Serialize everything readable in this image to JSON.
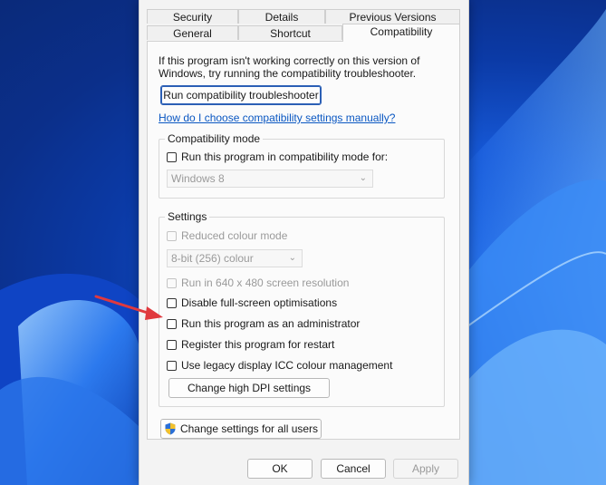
{
  "tabs": {
    "row1": [
      "Security",
      "Details",
      "Previous Versions"
    ],
    "row2": [
      "General",
      "Shortcut",
      "Compatibility"
    ]
  },
  "intro_text": "If this program isn't working correctly on this version of Windows, try running the compatibility troubleshooter.",
  "troubleshooter_button": "Run compatibility troubleshooter",
  "help_link": "How do I choose compatibility settings manually?",
  "compat_mode": {
    "title": "Compatibility mode",
    "checkbox": "Run this program in compatibility mode for:",
    "selected": "Windows 8"
  },
  "settings": {
    "title": "Settings",
    "reduced_colour": "Reduced colour mode",
    "colour_selected": "8-bit (256) colour",
    "res_640": "Run in 640 x 480 screen resolution",
    "disable_fullscreen": "Disable full-screen optimisations",
    "run_admin": "Run this program as an administrator",
    "register_restart": "Register this program for restart",
    "legacy_icc": "Use legacy display ICC colour management",
    "dpi_button": "Change high DPI settings"
  },
  "all_users_button": "Change settings for all users",
  "footer": {
    "ok": "OK",
    "cancel": "Cancel",
    "apply": "Apply"
  },
  "colors": {
    "accent": "#0a57c2",
    "arrow": "#e0393e"
  }
}
